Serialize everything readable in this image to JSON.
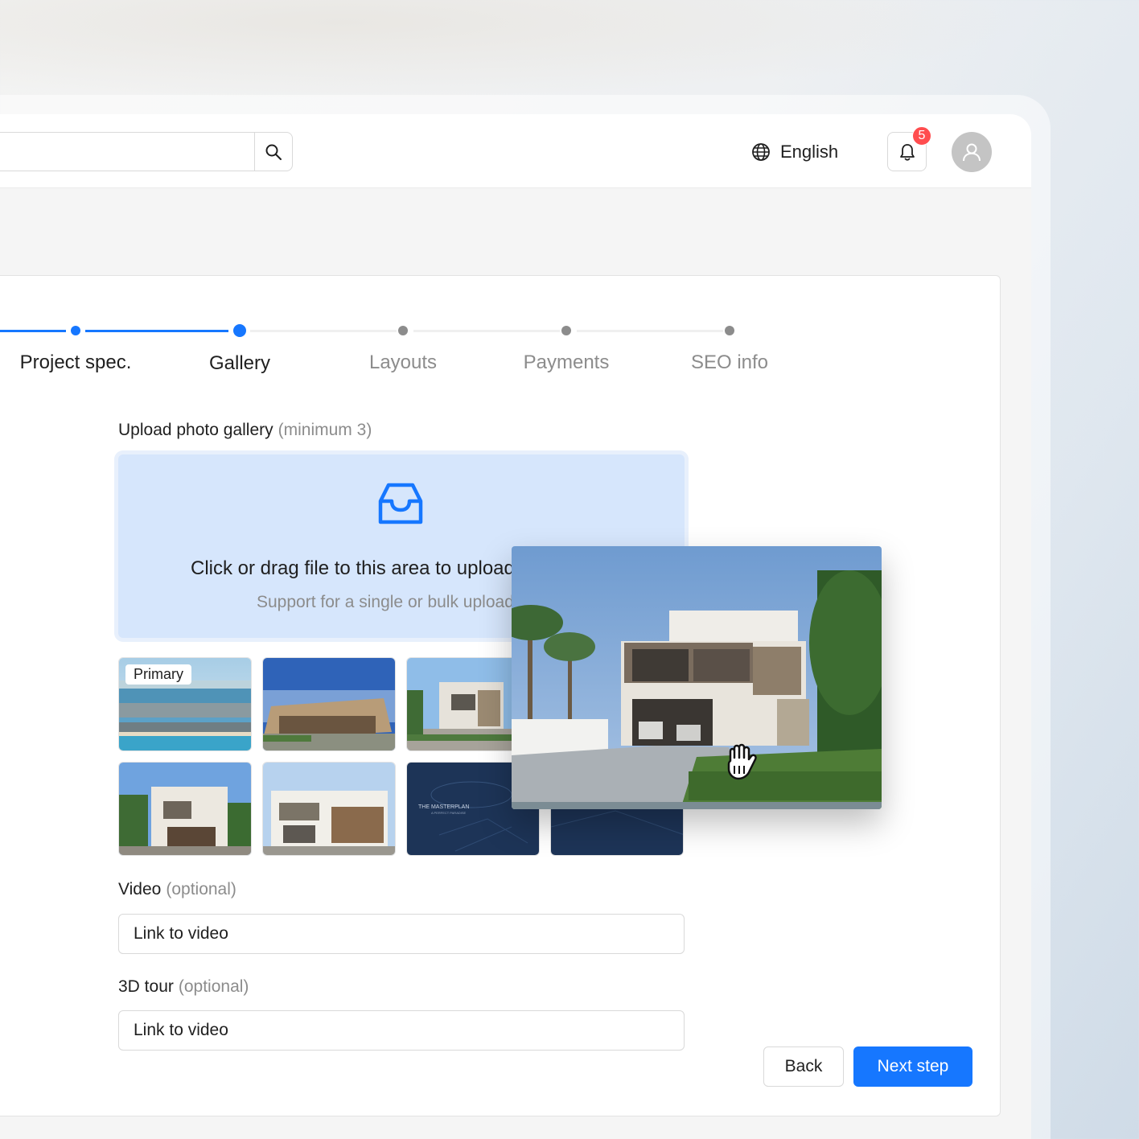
{
  "header": {
    "search_placeholder": "",
    "language": "English",
    "notifications_count": "5"
  },
  "steps": [
    {
      "label": "Project spec.",
      "state": "done"
    },
    {
      "label": "Gallery",
      "state": "active"
    },
    {
      "label": "Layouts",
      "state": "pending"
    },
    {
      "label": "Payments",
      "state": "pending"
    },
    {
      "label": "SEO info",
      "state": "pending"
    }
  ],
  "gallery": {
    "title": "Upload photo gallery",
    "hint": "(minimum 3)",
    "dropzone_text": "Click or drag file to this area to upload",
    "dropzone_hint": "Support for a single or bulk upload",
    "primary_tag": "Primary",
    "masterplan_caption": "THE MASTERPLAN",
    "masterplan_sub": "A PERFECT PARADISE"
  },
  "video": {
    "title": "Video",
    "hint": "(optional)",
    "value": "Link to video"
  },
  "tour": {
    "title": "3D tour",
    "hint": "(optional)",
    "value": "Link to video"
  },
  "actions": {
    "back": "Back",
    "next": "Next step"
  },
  "colors": {
    "accent": "#1677ff",
    "dropzone": "#d6e6fc",
    "badge": "#ff4d4f"
  }
}
